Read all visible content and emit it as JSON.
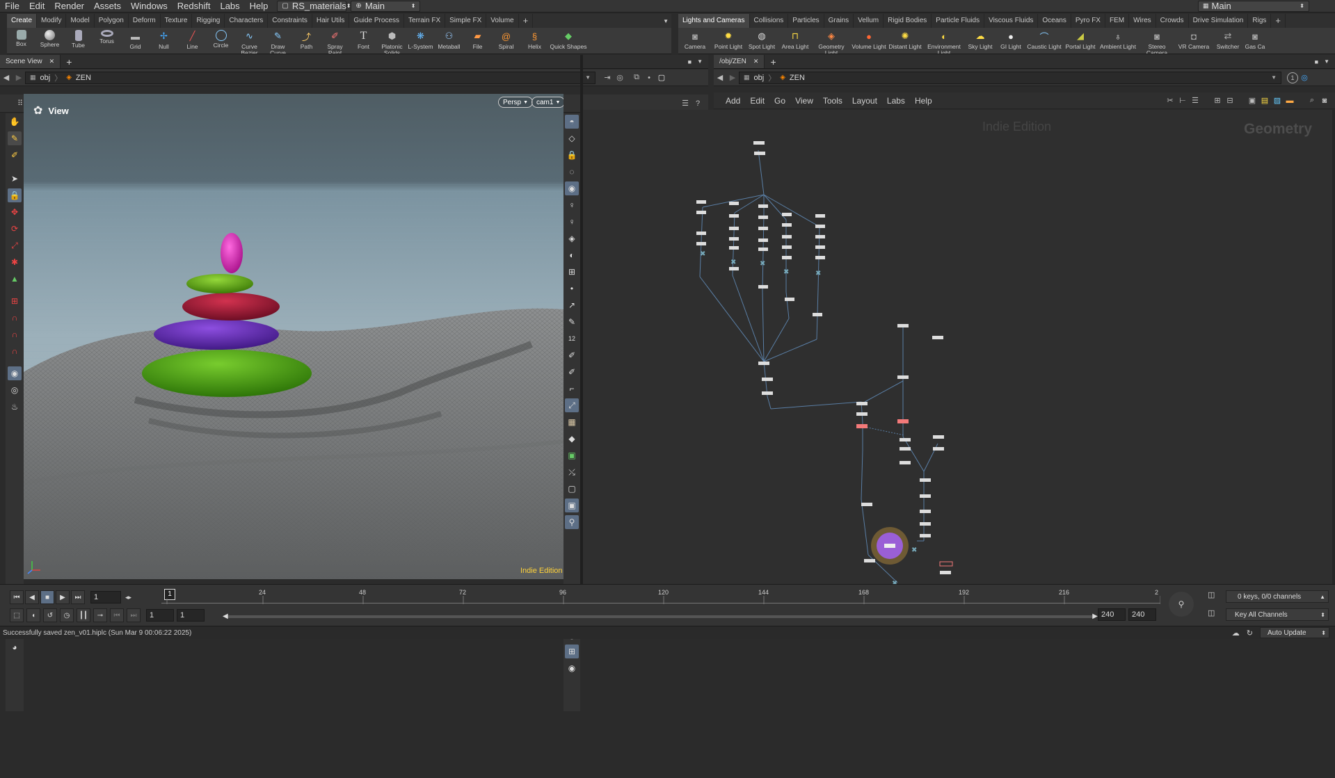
{
  "menubar": {
    "items": [
      "File",
      "Edit",
      "Render",
      "Assets",
      "Windows",
      "Redshift",
      "Labs",
      "Help"
    ],
    "desktop_file": "RS_materials",
    "desktop_name": "Main",
    "right_desktop": "Main"
  },
  "shelf_left": {
    "tabs": [
      "Create",
      "Modify",
      "Model",
      "Polygon",
      "Deform",
      "Texture",
      "Rigging",
      "Characters",
      "Constraints",
      "Hair Utils",
      "Guide Process",
      "Terrain FX",
      "Simple FX",
      "Volume"
    ],
    "active": 0,
    "tools": [
      "Box",
      "Sphere",
      "Tube",
      "Torus",
      "Grid",
      "Null",
      "Line",
      "Circle",
      "Curve Bezier",
      "Draw Curve",
      "Path",
      "Spray Paint",
      "Font",
      "Platonic Solids",
      "L-System",
      "Metaball",
      "File",
      "Spiral",
      "Helix",
      "Quick Shapes"
    ]
  },
  "shelf_right": {
    "tabs": [
      "Lights and Cameras",
      "Collisions",
      "Particles",
      "Grains",
      "Vellum",
      "Rigid Bodies",
      "Particle Fluids",
      "Viscous Fluids",
      "Oceans",
      "Pyro FX",
      "FEM",
      "Wires",
      "Crowds",
      "Drive Simulation",
      "Rigs"
    ],
    "active": 0,
    "tools": [
      "Camera",
      "Point Light",
      "Spot Light",
      "Area Light",
      "Geometry Light",
      "Volume Light",
      "Distant Light",
      "Environment Light",
      "Sky Light",
      "GI Light",
      "Caustic Light",
      "Portal Light",
      "Ambient Light",
      "Stereo Camera",
      "VR Camera",
      "Switcher",
      "Gas Ca"
    ]
  },
  "left_pane": {
    "tab": "Scene View",
    "path_root": "obj",
    "path_node": "ZEN",
    "view_label": "View",
    "persp": "Persp",
    "cam": "cam1",
    "edition": "Indie Edition"
  },
  "right_pane": {
    "tab": "/obj/ZEN",
    "path_root": "obj",
    "path_node": "ZEN",
    "menu": [
      "Add",
      "Edit",
      "Go",
      "View",
      "Tools",
      "Layout",
      "Labs",
      "Help"
    ],
    "watermark": "Indie Edition",
    "context": "Geometry",
    "page_num": "1"
  },
  "timeline": {
    "current_frame": "1",
    "marker": "1",
    "ticks": [
      "24",
      "48",
      "72",
      "96",
      "120",
      "144",
      "168",
      "192",
      "216",
      "2"
    ],
    "range_start": "1",
    "range_start2": "1",
    "range_end": "240",
    "range_end2": "240",
    "keys_info": "0 keys, 0/0 channels",
    "key_all": "Key All Channels"
  },
  "status": {
    "message": "Successfully saved zen_v01.hiplc (Sun Mar  9 00:06:22 2025)",
    "auto_update": "Auto Update"
  },
  "colors": {
    "stone_top": "#d11ca8",
    "stone_2": "#6fb010",
    "stone_3": "#a01a3a",
    "stone_4": "#6a2ab8",
    "stone_5": "#52a81a",
    "output_node": "#9a5fd6"
  }
}
